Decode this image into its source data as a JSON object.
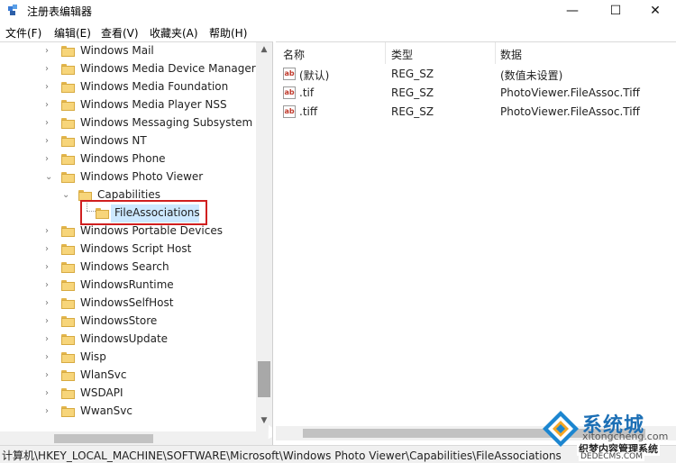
{
  "window": {
    "title": "注册表编辑器",
    "minimize_icon": "—",
    "maximize_icon": "☐",
    "close_icon": "✕"
  },
  "menu": [
    "文件(F)",
    "编辑(E)",
    "查看(V)",
    "收藏夹(A)",
    "帮助(H)"
  ],
  "tree": {
    "items": [
      {
        "label": "Windows Mail",
        "expander": "›"
      },
      {
        "label": "Windows Media Device Manager",
        "expander": "›"
      },
      {
        "label": "Windows Media Foundation",
        "expander": "›"
      },
      {
        "label": "Windows Media Player NSS",
        "expander": "›"
      },
      {
        "label": "Windows Messaging Subsystem",
        "expander": "›"
      },
      {
        "label": "Windows NT",
        "expander": "›"
      },
      {
        "label": "Windows Phone",
        "expander": "›"
      },
      {
        "label": "Windows Photo Viewer",
        "expander": "⌄"
      },
      {
        "label": "Capabilities",
        "expander": "⌄"
      },
      {
        "label": "FileAssociations",
        "expander": ""
      },
      {
        "label": "Windows Portable Devices",
        "expander": "›"
      },
      {
        "label": "Windows Script Host",
        "expander": "›"
      },
      {
        "label": "Windows Search",
        "expander": "›"
      },
      {
        "label": "WindowsRuntime",
        "expander": "›"
      },
      {
        "label": "WindowsSelfHost",
        "expander": "›"
      },
      {
        "label": "WindowsStore",
        "expander": "›"
      },
      {
        "label": "WindowsUpdate",
        "expander": "›"
      },
      {
        "label": "Wisp",
        "expander": "›"
      },
      {
        "label": "WlanSvc",
        "expander": "›"
      },
      {
        "label": "WSDAPI",
        "expander": "›"
      },
      {
        "label": "WwanSvc",
        "expander": "›"
      }
    ],
    "selected": "FileAssociations"
  },
  "list": {
    "headers": {
      "name": "名称",
      "type": "类型",
      "data": "数据"
    },
    "rows": [
      {
        "name": "(默认)",
        "type": "REG_SZ",
        "data": "(数值未设置)"
      },
      {
        "name": ".tif",
        "type": "REG_SZ",
        "data": "PhotoViewer.FileAssoc.Tiff"
      },
      {
        "name": ".tiff",
        "type": "REG_SZ",
        "data": "PhotoViewer.FileAssoc.Tiff"
      }
    ],
    "value_icon": "ab"
  },
  "statusbar": {
    "path": "计算机\\HKEY_LOCAL_MACHINE\\SOFTWARE\\Microsoft\\Windows Photo Viewer\\Capabilities\\FileAssociations"
  },
  "watermark": {
    "line1": "系统城",
    "line2": "xitongcheng.com",
    "line3": "织梦内容管理系统",
    "line4": "DEDECMS.COM"
  },
  "colors": {
    "selection": "#cce8ff",
    "highlight_border": "#d01f1f",
    "folder": "#f7d57a"
  }
}
